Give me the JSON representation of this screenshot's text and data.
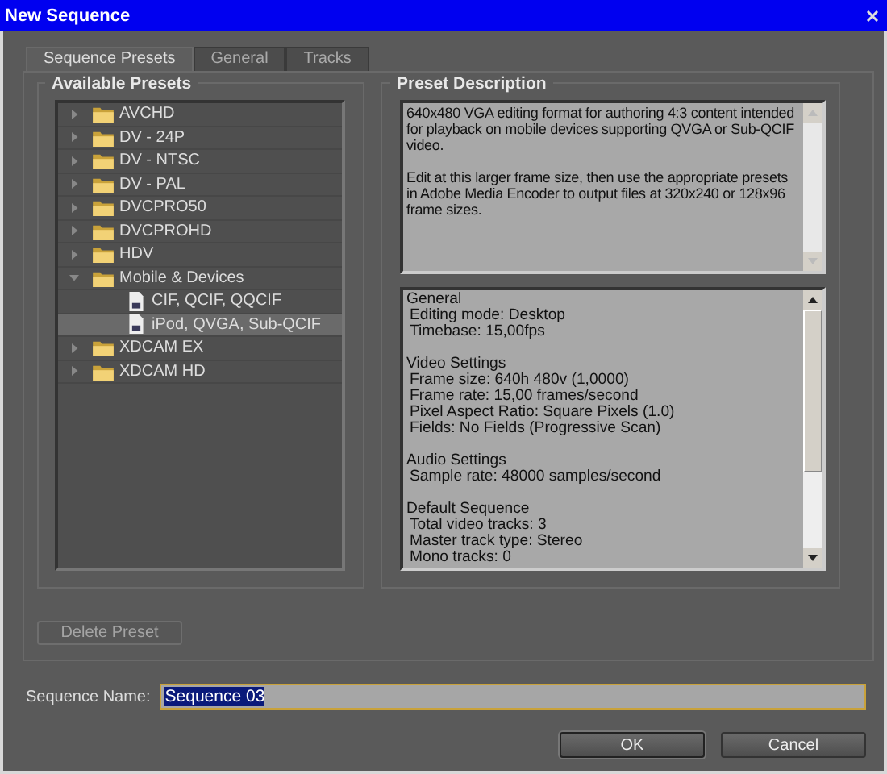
{
  "window": {
    "title": "New Sequence"
  },
  "tabs": [
    {
      "label": "Sequence Presets",
      "selected": true
    },
    {
      "label": "General",
      "selected": false
    },
    {
      "label": "Tracks",
      "selected": false
    }
  ],
  "available_presets": {
    "heading": "Available Presets",
    "tree": [
      {
        "kind": "folder",
        "label": "AVCHD",
        "expanded": false,
        "selected": false
      },
      {
        "kind": "folder",
        "label": "DV - 24P",
        "expanded": false,
        "selected": false
      },
      {
        "kind": "folder",
        "label": "DV - NTSC",
        "expanded": false,
        "selected": false
      },
      {
        "kind": "folder",
        "label": "DV - PAL",
        "expanded": false,
        "selected": false
      },
      {
        "kind": "folder",
        "label": "DVCPRO50",
        "expanded": false,
        "selected": false
      },
      {
        "kind": "folder",
        "label": "DVCPROHD",
        "expanded": false,
        "selected": false
      },
      {
        "kind": "folder",
        "label": "HDV",
        "expanded": false,
        "selected": false
      },
      {
        "kind": "folder",
        "label": "Mobile & Devices",
        "expanded": true,
        "selected": false,
        "children": [
          {
            "kind": "preset",
            "label": "CIF, QCIF, QQCIF",
            "selected": false
          },
          {
            "kind": "preset",
            "label": "iPod, QVGA, Sub-QCIF",
            "selected": true
          }
        ]
      },
      {
        "kind": "folder",
        "label": "XDCAM EX",
        "expanded": false,
        "selected": false
      },
      {
        "kind": "folder",
        "label": "XDCAM HD",
        "expanded": false,
        "selected": false
      }
    ],
    "delete_button": {
      "label": "Delete Preset",
      "disabled": true
    }
  },
  "preset_description": {
    "heading": "Preset Description",
    "paragraphs": [
      "640x480 VGA editing format for authoring 4:3 content intended for playback on mobile devices supporting QVGA or Sub-QCIF video.",
      "Edit at this larger frame size, then use the appropriate presets in Adobe Media Encoder to output files at 320x240 or 128x96 frame sizes."
    ],
    "details": [
      {
        "heading": "General",
        "lines": [
          "Editing mode: Desktop",
          "Timebase: 15,00fps"
        ]
      },
      {
        "heading": "Video Settings",
        "lines": [
          "Frame size: 640h 480v (1,0000)",
          "Frame rate: 15,00 frames/second",
          "Pixel Aspect Ratio: Square Pixels (1.0)",
          "Fields: No Fields (Progressive Scan)"
        ]
      },
      {
        "heading": "Audio Settings",
        "lines": [
          "Sample rate: 48000 samples/second"
        ]
      },
      {
        "heading": "Default Sequence",
        "lines": [
          "Total video tracks: 3",
          "Master track type: Stereo",
          "Mono tracks: 0"
        ]
      }
    ]
  },
  "sequence_name": {
    "label": "Sequence Name:",
    "value": "Sequence 03",
    "value_selected": true
  },
  "buttons": [
    {
      "label": "OK",
      "default": true
    },
    {
      "label": "Cancel",
      "default": false
    }
  ]
}
